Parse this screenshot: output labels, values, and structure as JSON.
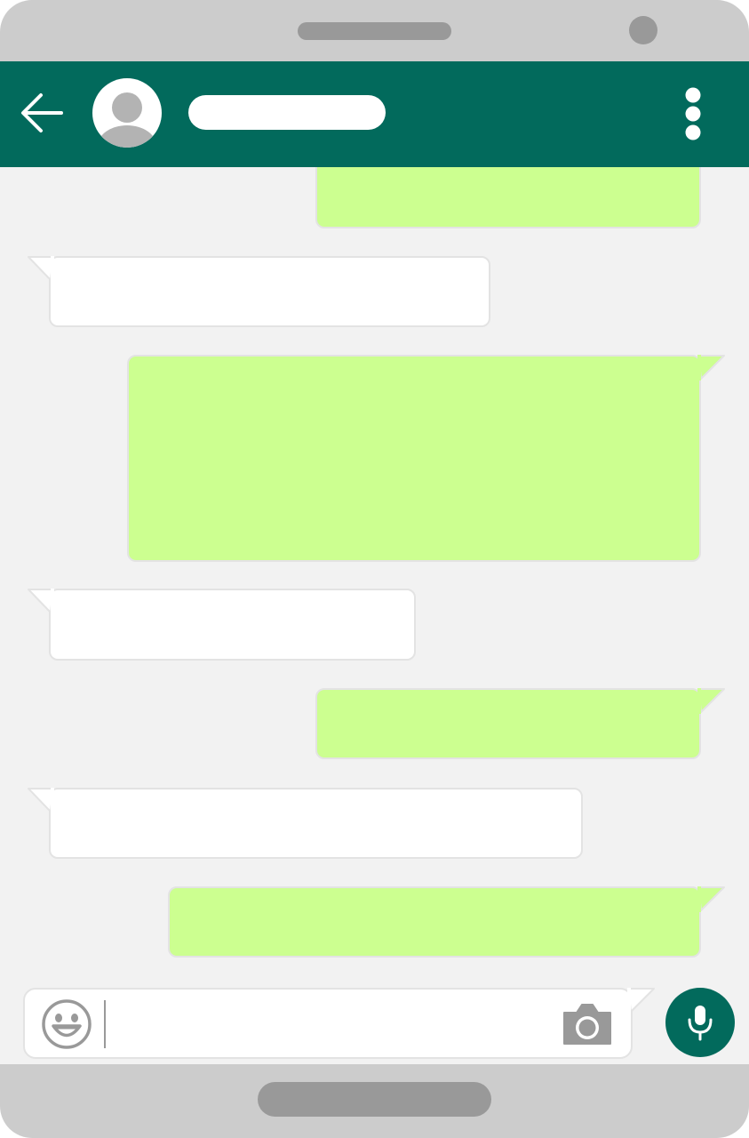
{
  "theme": {
    "header_color": "#026a5c",
    "incoming_bubble_color": "#ffffff",
    "outgoing_bubble_color": "#ccff90",
    "chat_background": "#f2f2f2",
    "phone_frame_color": "#cccccc"
  },
  "header": {
    "back_icon": "arrow-left-icon",
    "avatar_icon": "user-silhouette-icon",
    "contact_name": "",
    "menu_icon": "more-vertical-icon"
  },
  "messages": [
    {
      "direction": "outgoing",
      "text": ""
    },
    {
      "direction": "incoming",
      "text": ""
    },
    {
      "direction": "outgoing",
      "text": ""
    },
    {
      "direction": "incoming",
      "text": ""
    },
    {
      "direction": "outgoing",
      "text": ""
    },
    {
      "direction": "incoming",
      "text": ""
    },
    {
      "direction": "outgoing",
      "text": ""
    }
  ],
  "composer": {
    "emoji_icon": "emoji-smile-icon",
    "message_value": "",
    "placeholder": "",
    "camera_icon": "camera-icon",
    "mic_icon": "microphone-icon"
  }
}
